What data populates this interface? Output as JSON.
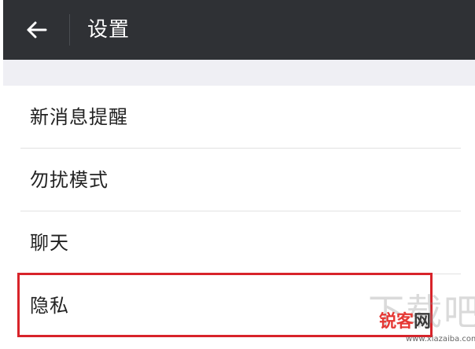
{
  "header": {
    "title": "设置",
    "back_icon": "arrow-left-icon"
  },
  "settings": {
    "items": [
      {
        "label": "新消息提醒"
      },
      {
        "label": "勿扰模式"
      },
      {
        "label": "聊天"
      },
      {
        "label": "隐私"
      }
    ],
    "highlighted_item": "隐私",
    "highlight_color": "#d8232a"
  },
  "watermark": {
    "ghost_text": "下载吧",
    "brand_part1": "锐客",
    "brand_part2": "网",
    "url": "www.xiazaiba.com"
  },
  "colors": {
    "topbar_bg": "#2f3135",
    "gap_bg": "#efeff4",
    "text": "#222222"
  }
}
